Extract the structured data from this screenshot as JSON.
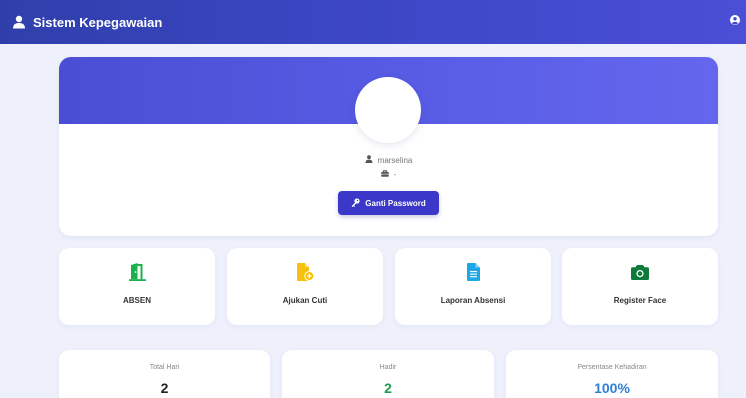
{
  "app": {
    "title": "Sistem Kepegawaian",
    "accent_color": "#3b37c9",
    "navbar_icon": "user-icon",
    "user_menu_icon": "user-circle-icon"
  },
  "profile": {
    "username": "marselina",
    "position": "-",
    "username_icon": "user-icon",
    "position_icon": "briefcase-icon",
    "change_password_label": "Ganti Password",
    "change_password_icon": "key-icon"
  },
  "menu": [
    {
      "label": "ABSEN",
      "icon": "door-open-icon",
      "color": "#1bb24b"
    },
    {
      "label": "Ajukan Cuti",
      "icon": "file-plus-icon",
      "color": "#f5c00e"
    },
    {
      "label": "Laporan Absensi",
      "icon": "file-text-icon",
      "color": "#1ea7e6"
    },
    {
      "label": "Register Face",
      "icon": "camera-icon",
      "color": "#0f7a3c"
    }
  ],
  "stats": [
    {
      "label": "Total Hari",
      "value": "2",
      "color": "#222222"
    },
    {
      "label": "Hadir",
      "value": "2",
      "color": "#1f9a52"
    },
    {
      "label": "Persentase Kehadiran",
      "value": "100%",
      "color": "#2e7fd8"
    }
  ]
}
